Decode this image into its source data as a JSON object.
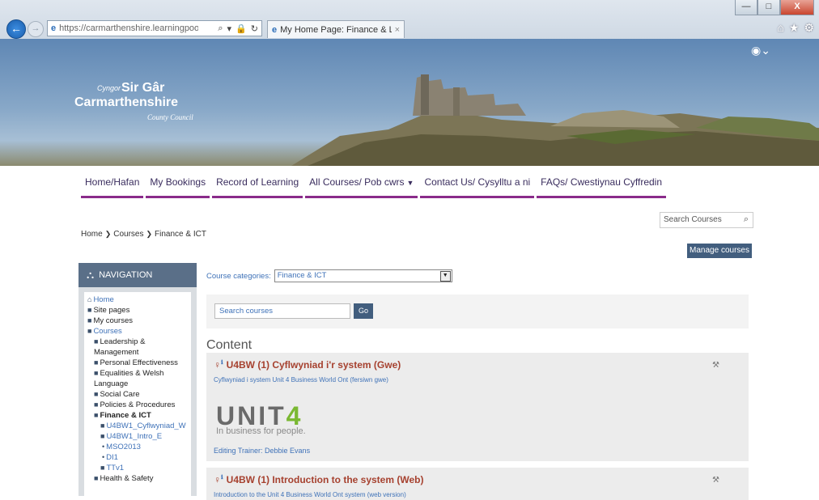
{
  "browser": {
    "url": "https://carmarthenshire.learningpool.com/cour:",
    "url_host": "carmarthenshire.learningpool.com",
    "tab_title": "My Home Page: Finance & L...",
    "window_buttons": {
      "minimize": "—",
      "maximize": "□",
      "close": "X"
    }
  },
  "banner": {
    "logo_cyngor": "Cyngor",
    "logo_sirgar": "Sir Gâr",
    "logo_carmarthenshire": "Carmarthenshire",
    "logo_county_council": "County Council"
  },
  "topnav": {
    "items": [
      "Home/Hafan",
      "My Bookings",
      "Record of Learning",
      "All Courses/ Pob cwrs",
      "Contact Us/ Cysylltu a ni",
      "FAQs/ Cwestiynau Cyffredin"
    ]
  },
  "header_search": {
    "placeholder": "Search Courses"
  },
  "breadcrumb": {
    "items": [
      "Home",
      "Courses",
      "Finance & ICT"
    ]
  },
  "manage_courses_label": "Manage courses",
  "navigation": {
    "title": "NAVIGATION",
    "tree": {
      "home": "Home",
      "site_pages": "Site pages",
      "my_courses": "My courses",
      "courses": "Courses",
      "leadership": "Leadership & Management",
      "personal": "Personal Effectiveness",
      "equalities": "Equalities & Welsh Language",
      "social_care": "Social Care",
      "policies": "Policies & Procedures",
      "finance": "Finance & ICT",
      "u4bw1_cyf": "U4BW1_Cyflwyniad_W",
      "u4bw1_intro": "U4BW1_Intro_E",
      "mso2013": "MSO2013",
      "di1": "DI1",
      "ttv1": "TTv1",
      "health_safety": "Health & Safety"
    }
  },
  "category": {
    "label": "Course categories:",
    "selected": "Finance & ICT"
  },
  "course_search": {
    "placeholder": "Search courses",
    "button": "Go"
  },
  "content_heading": "Content",
  "courses": [
    {
      "title": "U4BW (1) Cyflwyniad i'r system (Gwe)",
      "description": "Cyflwyniad i system Unit 4 Business World Ont (fersiwn gwe)",
      "logo_text": "UNIT",
      "logo_digit": "4",
      "logo_tagline": "In business for people.",
      "trainer": "Editing Trainer: Debbie Evans"
    },
    {
      "title": "U4BW (1) Introduction to the system (Web)",
      "description": "Introduction to the Unit 4 Business World Ont system (web version)"
    }
  ],
  "colors": {
    "accent": "#8a2b8a",
    "nav_header": "#5a6f88",
    "button": "#425e7e",
    "course_title": "#a6412f",
    "link": "#3f72b8"
  }
}
